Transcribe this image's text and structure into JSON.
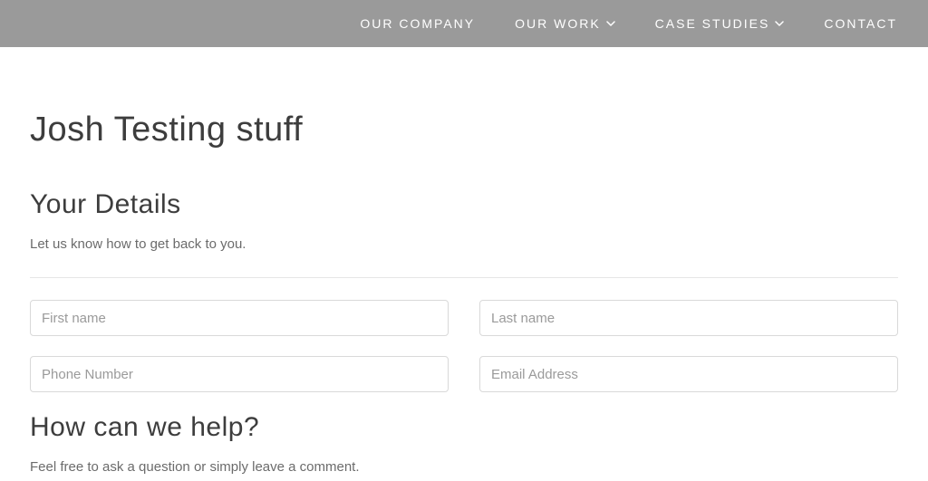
{
  "nav": {
    "items": [
      {
        "label": "OUR COMPANY",
        "hasDropdown": false
      },
      {
        "label": "OUR WORK",
        "hasDropdown": true
      },
      {
        "label": "CASE STUDIES",
        "hasDropdown": true
      },
      {
        "label": "CONTACT",
        "hasDropdown": false
      }
    ]
  },
  "page": {
    "title": "Josh Testing stuff"
  },
  "section1": {
    "title": "Your Details",
    "subtitle": "Let us know how to get back to you."
  },
  "form": {
    "firstName": {
      "placeholder": "First name",
      "value": ""
    },
    "lastName": {
      "placeholder": "Last name",
      "value": ""
    },
    "phone": {
      "placeholder": "Phone Number",
      "value": ""
    },
    "email": {
      "placeholder": "Email Address",
      "value": ""
    }
  },
  "section2": {
    "title": "How can we help?",
    "subtitle": "Feel free to ask a question or simply leave a comment."
  }
}
